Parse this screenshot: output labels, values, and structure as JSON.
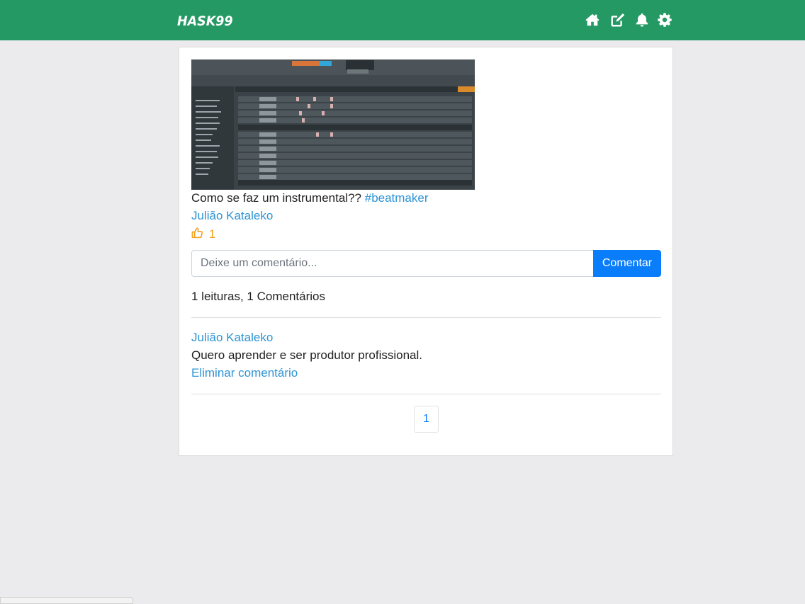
{
  "navbar": {
    "brand": "HASK99",
    "icons": [
      "home-icon",
      "edit-icon",
      "bell-icon",
      "gear-icon"
    ],
    "color": "#249964"
  },
  "post": {
    "image_alt": "FL Studio channel rack screenshot",
    "caption": "Como se faz um instrumental??",
    "hashtag": "#beatmaker",
    "author": "Julião Kataleko",
    "likes": "1"
  },
  "comment_form": {
    "placeholder": "Deixe um comentário...",
    "submit_label": "Comentar"
  },
  "stats": "1 leituras, 1 Comentários",
  "comments": [
    {
      "author": "Julião Kataleko",
      "text": "Quero aprender e ser produtor profissional.",
      "delete_label": "Eliminar comentário"
    }
  ],
  "pagination": {
    "current": "1"
  },
  "colors": {
    "accent": "#0a7dfb",
    "link": "#2e94d4",
    "like": "#f2a11d",
    "background": "#ebeaec"
  }
}
